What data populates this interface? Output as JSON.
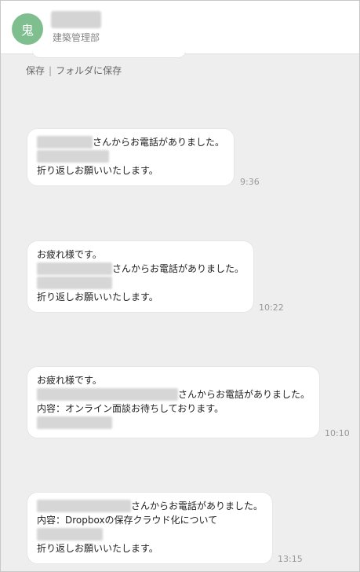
{
  "colors": {
    "avatar_bg": "#7fbf8f",
    "chat_bg": "#eeeeee",
    "bubble_bg": "#ffffff"
  },
  "header": {
    "avatar_char": "鬼",
    "department": "建築管理部"
  },
  "file_actions": {
    "save": "保存",
    "separator": "|",
    "save_to_folder": "フォルダに保存"
  },
  "messages": [
    {
      "call_text": "さんからお電話がありました。",
      "request": "折り返しお願いいたします。",
      "time": "9:36"
    },
    {
      "greeting": "お疲れ様です。",
      "call_text": "さんからお電話がありました。",
      "request": "折り返しお願いいたします。",
      "time": "10:22"
    },
    {
      "greeting": "お疲れ様です。",
      "call_text": "さんからお電話がありました。",
      "content": "内容：オンライン面談お待ちしております。",
      "time": "10:10"
    },
    {
      "call_text": "さんからお電話がありました。",
      "content": "内容：Dropboxの保存クラウド化について",
      "request": "折り返しお願いいたします。",
      "time": "13:15"
    }
  ]
}
